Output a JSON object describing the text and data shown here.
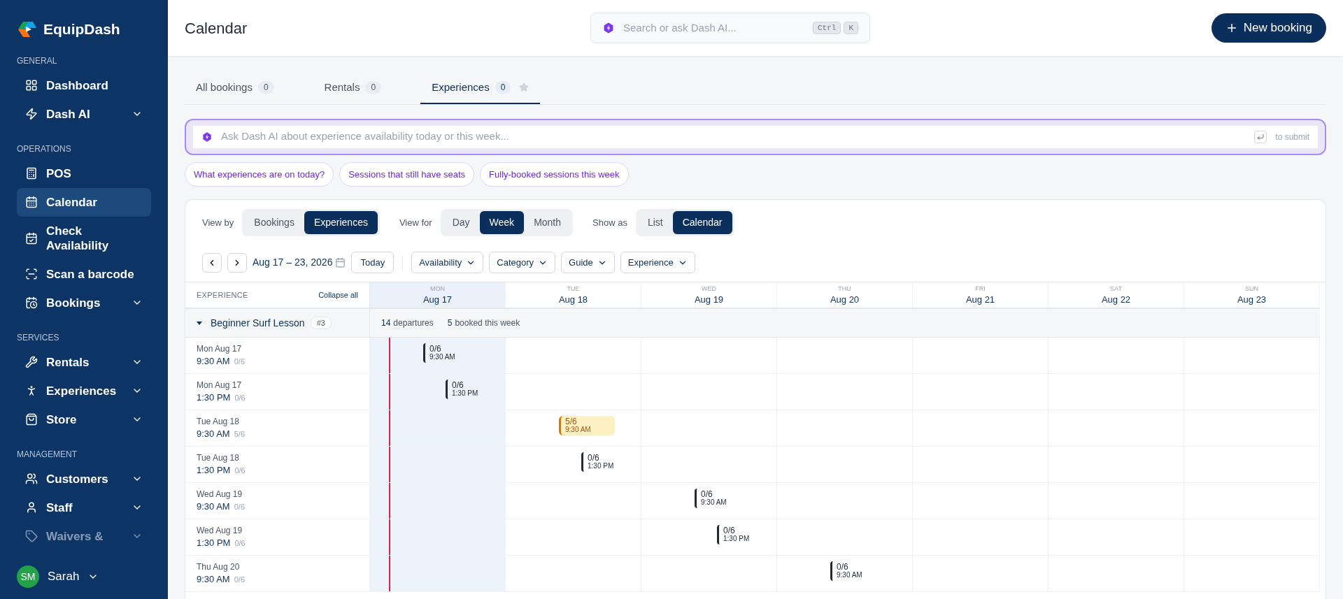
{
  "brand": {
    "name": "EquipDash"
  },
  "sidebar": {
    "sections": [
      {
        "title": "GENERAL",
        "items": [
          {
            "label": "Dashboard",
            "selected": false,
            "has_submenu": false,
            "faded": false
          },
          {
            "label": "Dash AI",
            "selected": false,
            "has_submenu": true,
            "faded": false
          }
        ]
      },
      {
        "title": "OPERATIONS",
        "items": [
          {
            "label": "POS",
            "selected": false,
            "has_submenu": false,
            "faded": false
          },
          {
            "label": "Calendar",
            "selected": true,
            "has_submenu": false,
            "faded": false
          },
          {
            "label": "Check Availability",
            "selected": false,
            "has_submenu": false,
            "faded": false
          },
          {
            "label": "Scan a barcode",
            "selected": false,
            "has_submenu": false,
            "faded": false
          },
          {
            "label": "Bookings",
            "selected": false,
            "has_submenu": true,
            "faded": false
          }
        ]
      },
      {
        "title": "SERVICES",
        "items": [
          {
            "label": "Rentals",
            "selected": false,
            "has_submenu": true,
            "faded": false
          },
          {
            "label": "Experiences",
            "selected": false,
            "has_submenu": true,
            "faded": false
          },
          {
            "label": "Store",
            "selected": false,
            "has_submenu": true,
            "faded": false
          }
        ]
      },
      {
        "title": "MANAGEMENT",
        "items": [
          {
            "label": "Customers",
            "selected": false,
            "has_submenu": true,
            "faded": false
          },
          {
            "label": "Staff",
            "selected": false,
            "has_submenu": true,
            "faded": false
          },
          {
            "label": "Waivers &",
            "selected": false,
            "has_submenu": true,
            "faded": true
          }
        ]
      }
    ],
    "user": {
      "initials": "SM",
      "name": "Sarah"
    }
  },
  "header": {
    "title": "Calendar",
    "search": {
      "placeholder": "Search or ask Dash AI...",
      "keys": [
        "Ctrl",
        "K"
      ]
    },
    "primary_button": "New booking"
  },
  "tabs": [
    {
      "label": "All bookings",
      "count": "0",
      "selected": false
    },
    {
      "label": "Rentals",
      "count": "0",
      "selected": false
    },
    {
      "label": "Experiences",
      "count": "0",
      "selected": true
    }
  ],
  "ai_box": {
    "placeholder": "Ask Dash AI about experience availability today or this week...",
    "submit_hint": "to submit"
  },
  "suggestions": [
    "What experiences are on today?",
    "Sessions that still have seats",
    "Fully-booked sessions this week"
  ],
  "toggles": [
    {
      "label": "View by",
      "options": [
        {
          "label": "Bookings",
          "selected": false
        },
        {
          "label": "Experiences",
          "selected": true
        }
      ]
    },
    {
      "label": "View for",
      "options": [
        {
          "label": "Day",
          "selected": false
        },
        {
          "label": "Week",
          "selected": true
        },
        {
          "label": "Month",
          "selected": false
        }
      ]
    },
    {
      "label": "Show as",
      "options": [
        {
          "label": "List",
          "selected": false
        },
        {
          "label": "Calendar",
          "selected": true
        }
      ]
    }
  ],
  "date_range": "Aug 17 – 23, 2026",
  "today_button": "Today",
  "filters": [
    "Availability",
    "Category",
    "Guide",
    "Experience"
  ],
  "grid": {
    "column_heading": "EXPERIENCE",
    "collapse_link": "Collapse all",
    "days": [
      {
        "dow": "MON",
        "date": "Aug 17",
        "today": true
      },
      {
        "dow": "TUE",
        "date": "Aug 18",
        "today": false
      },
      {
        "dow": "WED",
        "date": "Aug 19",
        "today": false
      },
      {
        "dow": "THU",
        "date": "Aug 20",
        "today": false
      },
      {
        "dow": "FRI",
        "date": "Aug 21",
        "today": false
      },
      {
        "dow": "SAT",
        "date": "Aug 22",
        "today": false
      },
      {
        "dow": "SUN",
        "date": "Aug 23",
        "today": false
      }
    ],
    "group": {
      "name": "Beginner Surf Lesson",
      "badge": "#3",
      "expanded": true,
      "departures_count": "14",
      "departures_label": "departures",
      "booked_count": "5",
      "booked_label": "booked this week"
    },
    "sessions": [
      {
        "date": "Mon Aug 17",
        "time": "9:30 AM",
        "seats": "0/6",
        "cells": [
          {
            "count": "0/6",
            "time": "9:30 AM",
            "kind": "open"
          },
          null,
          null,
          null,
          null,
          null,
          null
        ]
      },
      {
        "date": "Mon Aug 17",
        "time": "1:30 PM",
        "seats": "0/6",
        "cells": [
          {
            "count": "0/6",
            "time": "1:30 PM",
            "kind": "open"
          },
          null,
          null,
          null,
          null,
          null,
          null
        ]
      },
      {
        "date": "Tue Aug 18",
        "time": "9:30 AM",
        "seats": "5/6",
        "cells": [
          null,
          {
            "count": "5/6",
            "time": "9:30 AM",
            "kind": "filling"
          },
          null,
          null,
          null,
          null,
          null
        ]
      },
      {
        "date": "Tue Aug 18",
        "time": "1:30 PM",
        "seats": "0/6",
        "cells": [
          null,
          {
            "count": "0/6",
            "time": "1:30 PM",
            "kind": "open"
          },
          null,
          null,
          null,
          null,
          null
        ]
      },
      {
        "date": "Wed Aug 19",
        "time": "9:30 AM",
        "seats": "0/6",
        "cells": [
          null,
          null,
          {
            "count": "0/6",
            "time": "9:30 AM",
            "kind": "open"
          },
          null,
          null,
          null,
          null
        ]
      },
      {
        "date": "Wed Aug 19",
        "time": "1:30 PM",
        "seats": "0/6",
        "cells": [
          null,
          null,
          {
            "count": "0/6",
            "time": "1:30 PM",
            "kind": "open"
          },
          null,
          null,
          null,
          null
        ]
      },
      {
        "date": "Thu Aug 20",
        "time": "9:30 AM",
        "seats": "0/6",
        "cells": [
          null,
          null,
          null,
          {
            "count": "0/6",
            "time": "9:30 AM",
            "kind": "open"
          },
          null,
          null,
          null
        ]
      }
    ]
  }
}
